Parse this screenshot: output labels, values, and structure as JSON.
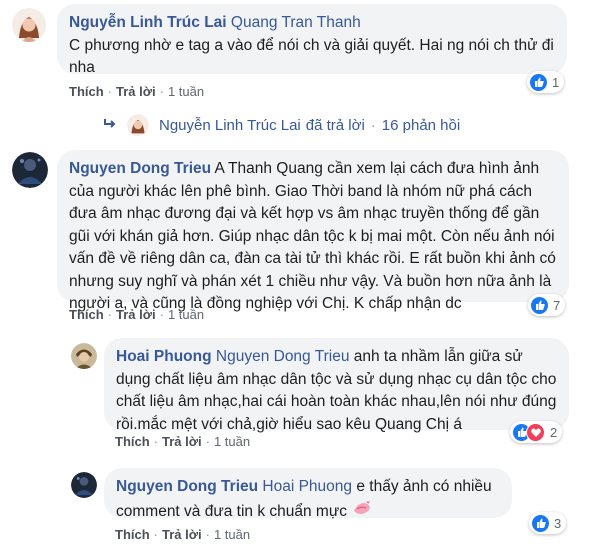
{
  "comments": [
    {
      "author": "Nguyễn Linh Trúc Lai",
      "tag": "Quang Tran Thanh",
      "line1": "C phương nhờ e tag a vào để nói ch và giải quyết. Hai ng nói ch thử đi",
      "line2": "nha",
      "like": "Thích",
      "reply": "Trả lời",
      "time": "1 tuần",
      "reaction_count": "1"
    },
    {
      "author": "Nguyen Dong Trieu",
      "lines": [
        "A Thanh Quang cần xem lại cách đưa hình ảnh",
        "của người khác lên phê bình. Giao Thời band là nhóm nữ phá cách",
        "đưa âm nhạc đương đại và kết hợp vs âm nhạc truyền thống để gần",
        "gũi với khán giả hơn. Giúp nhạc dân tộc k bị mai một. Còn nếu ảnh nói",
        "vấn đề về riêng dân ca, đàn ca tài tử thì khác rồi. E rất buồn khi ảnh có",
        "nhưng suy nghĩ và phán xét 1 chiều như vậy. Và buồn hơn nữa ảnh là",
        "người a, và cũng là đồng nghiệp với Chị. K chấp nhận dc"
      ],
      "like": "Thích",
      "reply": "Trả lời",
      "time": "1 tuần",
      "reaction_count": "7"
    },
    {
      "author": "Hoai Phuong",
      "tag": "Nguyen Dong Trieu",
      "lines": [
        "anh ta nhầm lẫn giữa sử",
        "dụng chất liệu âm nhạc dân tộc và sử dụng nhạc cụ dân tộc cho",
        "chất liệu âm nhạc,hai cái hoàn toàn khác nhau,lên nói như đúng",
        "rồi.mắc mệt với chả,giờ hiểu sao kêu Quang Chị á"
      ],
      "like": "Thích",
      "reply": "Trả lời",
      "time": "1 tuần",
      "reaction_count": "2"
    },
    {
      "author": "Nguyen Dong Trieu",
      "tag": "Hoai Phuong",
      "line1": "e thấy ảnh có nhiều",
      "line2": "comment và đưa tin k chuẩn mực",
      "like": "Thích",
      "reply": "Trả lời",
      "time": "1 tuần",
      "reaction_count": "3"
    }
  ],
  "replies_summary": {
    "author": "Nguyễn Linh Trúc Lai",
    "text": "đã trả lời",
    "separator": "·",
    "count": "16 phản hồi"
  },
  "separator": "·",
  "colors": {
    "link": "#385898",
    "bubble": "#f2f3f5",
    "like": "#1877f2",
    "love": "#f33e58"
  }
}
